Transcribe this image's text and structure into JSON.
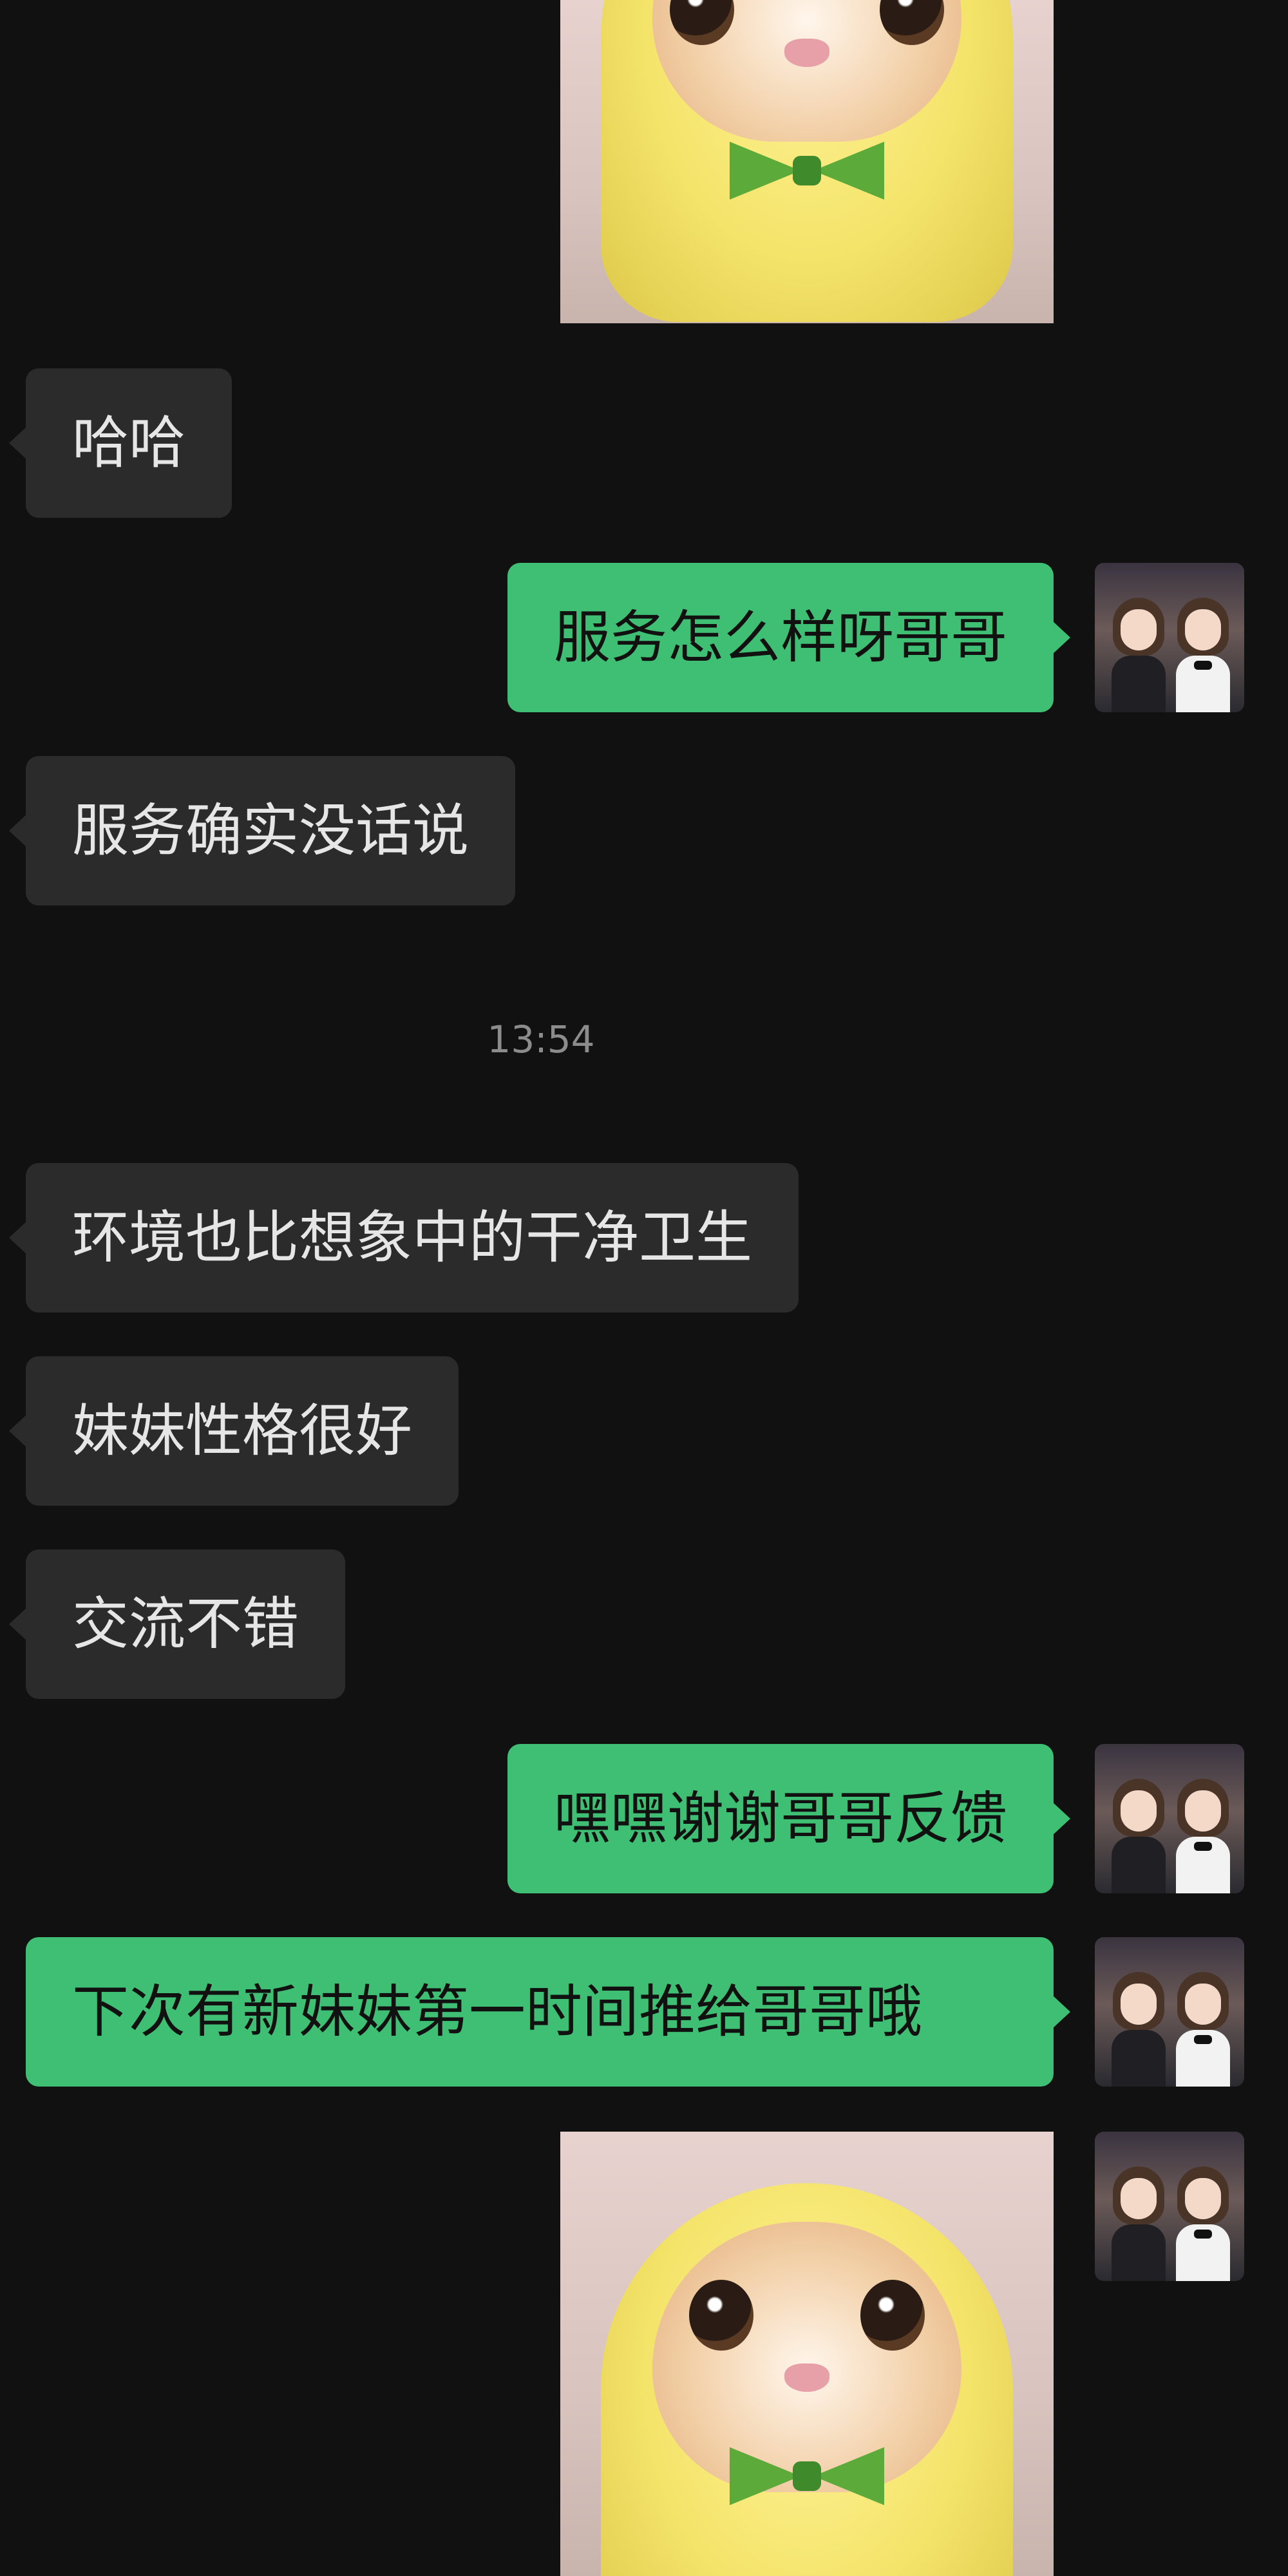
{
  "conversation": {
    "messages": [
      {
        "side": "in",
        "text": "哈哈"
      },
      {
        "side": "out",
        "text": "服务怎么样呀哥哥"
      },
      {
        "side": "in",
        "text": "服务确实没话说"
      },
      {
        "side": "in",
        "text": "环境也比想象中的干净卫生"
      },
      {
        "side": "in",
        "text": "妹妹性格很好"
      },
      {
        "side": "in",
        "text": "交流不错"
      },
      {
        "side": "out",
        "text": "嘿嘿谢谢哥哥反馈"
      },
      {
        "side": "out",
        "text": "下次有新妹妹第一时间推给哥哥哦"
      }
    ],
    "timestamp": "13:54",
    "stickers": [
      {
        "icon": "cat-banana-sticker"
      },
      {
        "icon": "cat-banana-sticker"
      }
    ]
  },
  "colors": {
    "background": "#111111",
    "incoming_bubble": "#2b2b2b",
    "outgoing_bubble": "#3fbf74",
    "timestamp_text": "#8c8c8c"
  }
}
